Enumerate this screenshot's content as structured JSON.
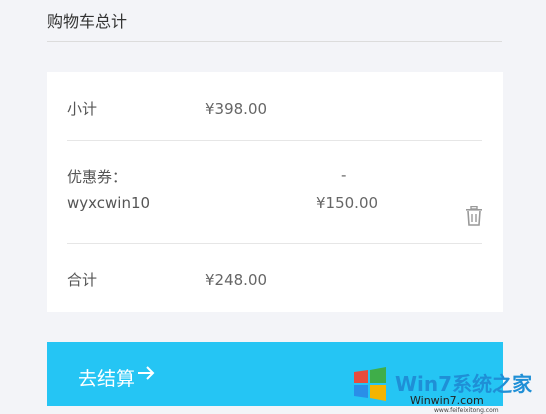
{
  "header": {
    "title": "购物车总计"
  },
  "summary": {
    "subtotal_label": "小计",
    "subtotal_value": "¥398.00",
    "coupon_label": "优惠券：",
    "coupon_code": "wyxcwin10",
    "coupon_dash": "-",
    "coupon_amount": "¥150.00",
    "total_label": "合计",
    "total_value": "¥248.00",
    "delete_icon": "trash-icon"
  },
  "checkout": {
    "label": "去结算",
    "icon": "arrow-right-icon",
    "color": "#25c5f4"
  },
  "watermark": {
    "text": "Win7系统之家",
    "domain": "Winwin7.com",
    "url": "www.feifeixitong.com"
  }
}
